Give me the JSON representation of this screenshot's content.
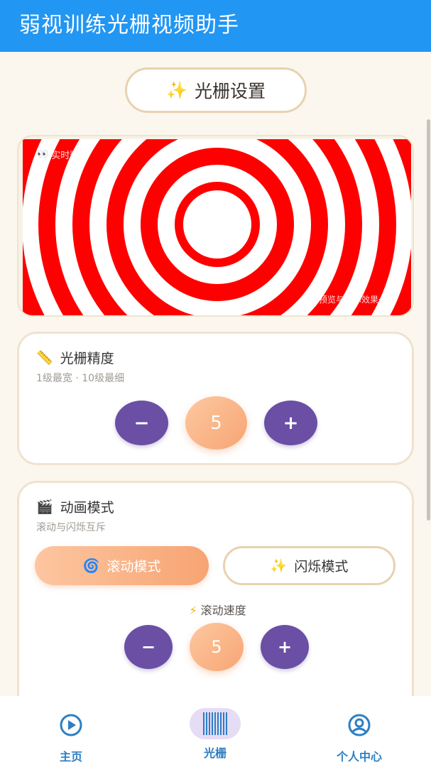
{
  "app": {
    "title": "弱视训练光栅视频助手"
  },
  "settings_button": {
    "icon": "sparkles-icon",
    "label": "光栅设置"
  },
  "preview": {
    "label": "实时预览",
    "note": "预览与实际效果一致",
    "colors": {
      "stripe": "#ff0000",
      "gap": "#ffffff"
    }
  },
  "precision": {
    "title": "光栅精度",
    "icon": "ruler-icon",
    "subtitle": "1级最宽 · 10级最细",
    "value": "5",
    "minus_label": "−",
    "plus_label": "+"
  },
  "animation": {
    "title": "动画模式",
    "icon": "clapper-icon",
    "subtitle": "滚动与闪烁互斥",
    "scroll_mode_label": "滚动模式",
    "flash_mode_label": "闪烁模式",
    "selected_mode": "scroll",
    "speed_label": "滚动速度",
    "speed_value": "5",
    "minus_label": "−",
    "plus_label": "+"
  },
  "nav": {
    "items": [
      {
        "label": "主页",
        "icon": "play-circle-icon"
      },
      {
        "label": "光栅",
        "icon": "barcode-icon"
      },
      {
        "label": "个人中心",
        "icon": "user-circle-icon"
      }
    ],
    "active_index": 1
  },
  "colors": {
    "appbar": "#2196f3",
    "accent_purple": "#6a4fa5",
    "accent_peach": "#f7a574",
    "nav_text": "#2d7fc4"
  }
}
